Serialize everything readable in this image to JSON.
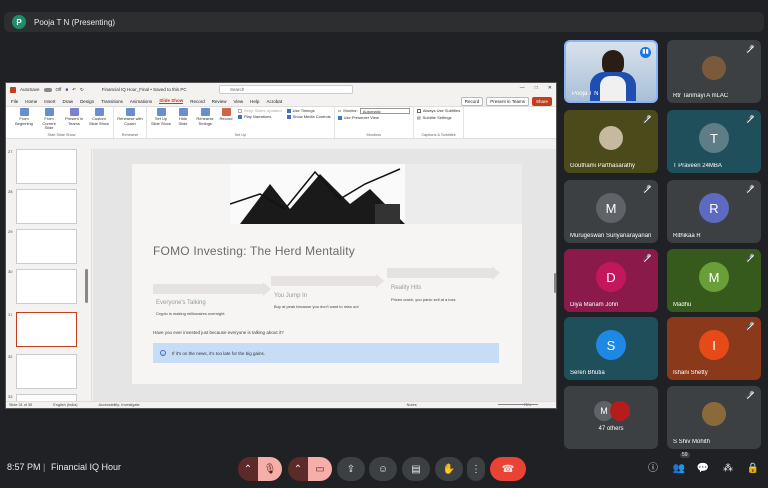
{
  "presenter": {
    "initial": "P",
    "label": "Pooja T N (Presenting)"
  },
  "ppt": {
    "autosave_label": "AutoSave",
    "autosave_state": "Off",
    "doc_title": "Financial IQ Hour_Final • Saved to this PC",
    "search_placeholder": "Search",
    "menu": [
      "File",
      "Home",
      "Insert",
      "Draw",
      "Design",
      "Transitions",
      "Animations",
      "Slide Show",
      "Record",
      "Review",
      "View",
      "Help",
      "Acrobat"
    ],
    "active_menu": "Slide Show",
    "record_btn": "Record",
    "present_teams_btn": "Present in Teams",
    "share_btn": "Share",
    "ribbon": {
      "start_items": [
        "From Beginning",
        "From Current Slide",
        "Present in Teams",
        "Custom Slide Show"
      ],
      "start_group": "Start Slide Show",
      "rehearse_item": "Rehearse with Coach",
      "rehearse_group": "Rehearse",
      "setup_items": [
        "Set Up Slide Show",
        "Hide Slide",
        "Rehearse Timings",
        "Record"
      ],
      "setup_checks": [
        "Keep Slides Updated",
        "Play Narrations",
        "Use Timings",
        "Show Media Controls"
      ],
      "setup_group": "Set Up",
      "monitor_label": "Monitor:",
      "monitor_value": "Automatic",
      "presenter_view": "Use Presenter View",
      "monitors_group": "Monitors",
      "subtitles_check": "Always Use Subtitles",
      "subtitle_settings": "Subtitle Settings",
      "captions_group": "Captions & Subtitles"
    },
    "thumb_numbers": [
      "27",
      "28",
      "29",
      "30",
      "31",
      "32",
      "33"
    ],
    "selected_thumb": "31",
    "slide": {
      "title": "FOMO Investing: The Herd Mentality",
      "steps": [
        {
          "label": "Everyone's Talking",
          "desc": "Crypto is making millionaires overnight"
        },
        {
          "label": "You Jump In",
          "desc": "Buy at peak because you don't want to miss out"
        },
        {
          "label": "Reality Hits",
          "desc": "Prices crash, you panic sell at a loss"
        }
      ],
      "question": "Have you ever invested just because everyone is talking about it?",
      "callout": "If it's on the news, it's too late for the big gains."
    },
    "status": {
      "slide_count": "Slide 31 of 35",
      "language": "English (India)",
      "accessibility": "Accessibility: Investigate",
      "notes": "Notes",
      "zoom": "75%"
    }
  },
  "participants": [
    {
      "name": "Pooja T N",
      "type": "video"
    },
    {
      "name": "Rtr Tanmayi A mLAC",
      "type": "photo"
    },
    {
      "name": "Gouthami Parthasarathy",
      "type": "photo"
    },
    {
      "name": "T Praveen 24MBA",
      "initial": "T"
    },
    {
      "name": "Murugeswari Suriyanarayanan",
      "initial": "M"
    },
    {
      "name": "Rithikaa R",
      "initial": "R"
    },
    {
      "name": "Diya Mariam John",
      "initial": "D"
    },
    {
      "name": "Madhu",
      "initial": "M"
    },
    {
      "name": "Seren Bhutia",
      "initial": "S"
    },
    {
      "name": "Ishani Shetty",
      "initial": "I"
    },
    {
      "name": "47 others",
      "initial": "M"
    },
    {
      "name": "S Shiv Mohith",
      "type": "photo"
    }
  ],
  "bottom": {
    "time": "8:57 PM",
    "separator": "|",
    "meeting": "Financial IQ Hour",
    "participants_badge": "59"
  },
  "colors": {
    "tile_bg_dark": "#3c4043",
    "tile_bg_teal": "#1f4f5a",
    "tile_bg_orange": "#8a3a1a",
    "tile_bg_green": "#355a1c",
    "tile_bg_pink": "#8a1a4a",
    "tile_bg_olive": "#4a4a1a",
    "leave_red": "#ea4335"
  }
}
